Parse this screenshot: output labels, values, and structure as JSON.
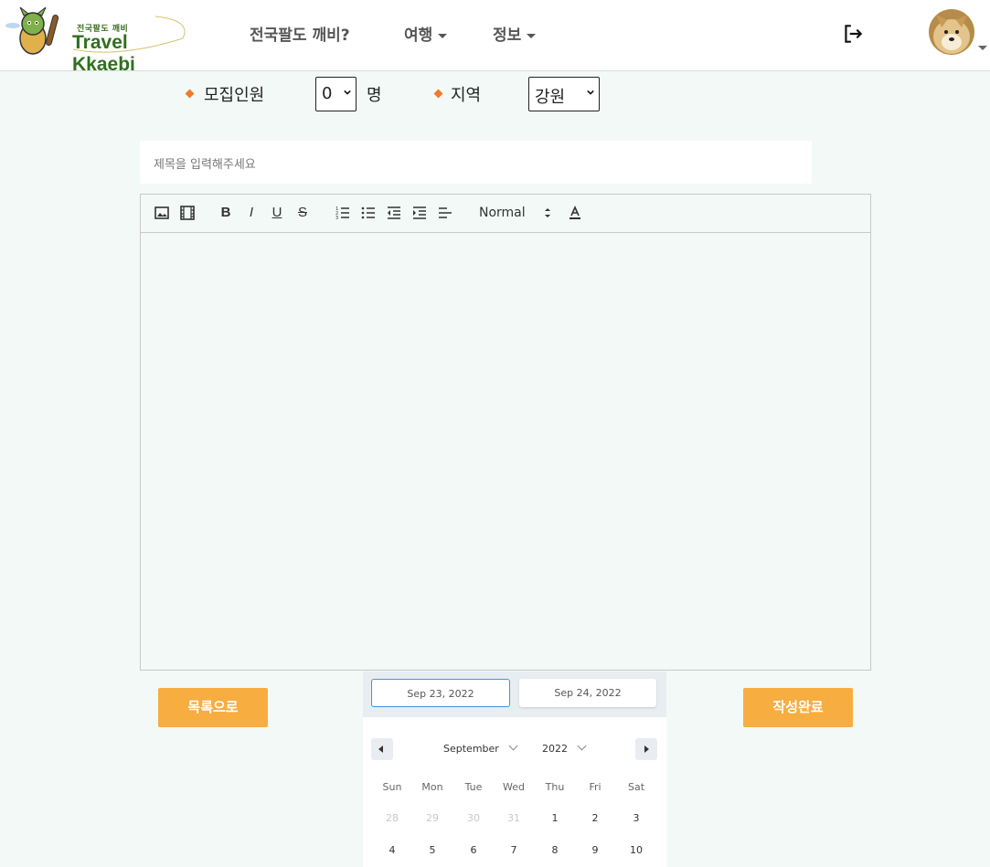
{
  "header": {
    "logo_small": "전국팔도 깨비",
    "logo_big": "Travel Kkaebi",
    "nav": [
      {
        "label": "전국팔도 깨비?"
      },
      {
        "label": "여행"
      },
      {
        "label": "정보"
      }
    ],
    "logout_icon": "logout-icon",
    "avatar_icon": "avatar"
  },
  "form": {
    "recruit_label": "모집인원",
    "recruit_value": "0",
    "recruit_unit": "명",
    "region_label": "지역",
    "region_value": "강원",
    "title_placeholder": "제목을 입력해주세요"
  },
  "editor": {
    "toolbar": {
      "bold": "B",
      "italic": "I",
      "underline": "U",
      "strike": "S",
      "header_select": "Normal"
    }
  },
  "buttons": {
    "back": "목록으로",
    "submit": "작성완료"
  },
  "datepicker": {
    "start_date": "Sep 23, 2022",
    "end_date": "Sep 24, 2022",
    "month": "September",
    "year": "2022",
    "weekdays": [
      "Sun",
      "Mon",
      "Tue",
      "Wed",
      "Thu",
      "Fri",
      "Sat"
    ],
    "weeks": [
      [
        "28",
        "29",
        "30",
        "31",
        "1",
        "2",
        "3"
      ],
      [
        "4",
        "5",
        "6",
        "7",
        "8",
        "9",
        "10"
      ]
    ]
  },
  "colors": {
    "accent": "#f7ad3f",
    "diamond": "#f07a2b",
    "background": "#f3f9f6"
  }
}
